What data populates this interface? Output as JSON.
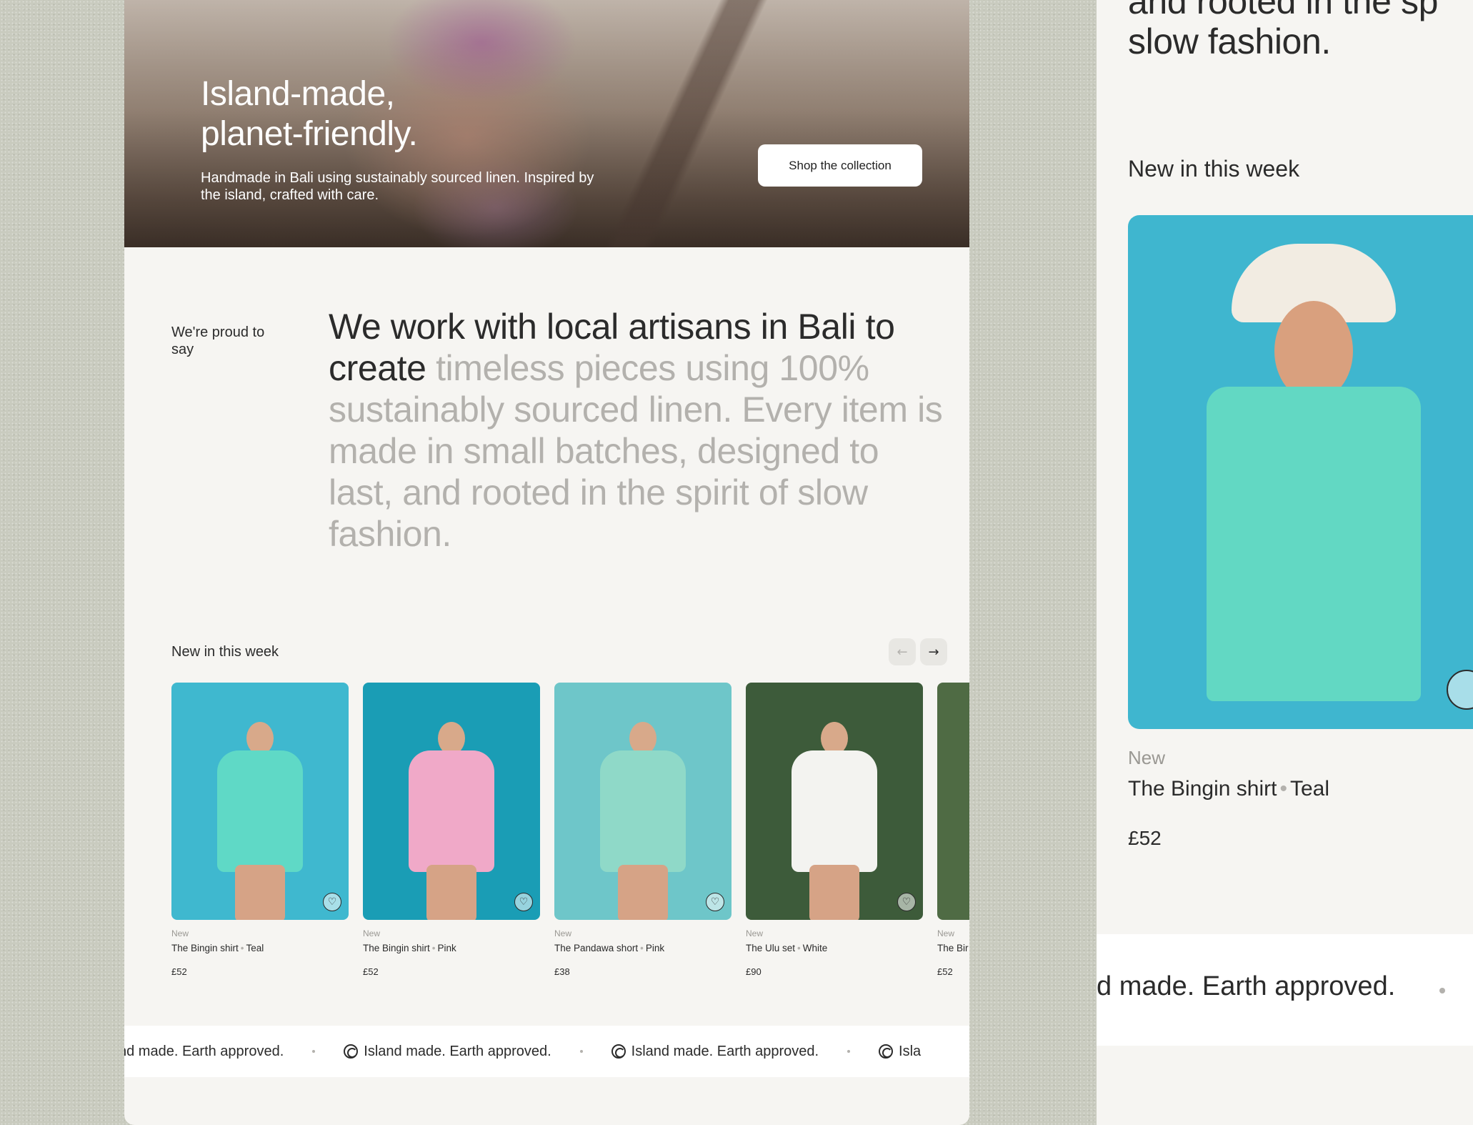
{
  "hero": {
    "title": "Island-made, planet-friendly.",
    "subtitle": "Handmade in Bali using sustainably sourced linen. Inspired by the island, crafted with care.",
    "cta_label": "Shop the collection"
  },
  "about": {
    "eyebrow": "We're proud to say",
    "statement_dark": "We work with local artisans in Bali to create ",
    "statement_light": "timeless pieces using 100% sustainably sourced linen. Every item is made in small batches, designed to last, and rooted in the spirit of slow fashion."
  },
  "new_in": {
    "heading": "New in this week",
    "prev_icon": "arrow-left-icon",
    "next_icon": "arrow-right-icon",
    "products": [
      {
        "tag": "New",
        "name": "The Bingin shirt",
        "color": "Teal",
        "price": "£52",
        "bg": "#3fb8cf",
        "outfit": "#5fd9c6"
      },
      {
        "tag": "New",
        "name": "The Bingin shirt",
        "color": "Pink",
        "price": "£52",
        "bg": "#1a9db5",
        "outfit": "#f0a9c8"
      },
      {
        "tag": "New",
        "name": "The Pandawa short",
        "color": "Pink",
        "price": "£38",
        "bg": "#6ec6c9",
        "outfit": "#8fd9c8"
      },
      {
        "tag": "New",
        "name": "The Ulu set",
        "color": "White",
        "price": "£90",
        "bg": "#3d5b3a",
        "outfit": "#f3f3f0"
      },
      {
        "tag": "New",
        "name": "The Bir",
        "color": "",
        "price": "£52",
        "bg": "#4f6b44",
        "outfit": "#e9e5dc"
      }
    ]
  },
  "marquee": {
    "first_partial": "nd made. Earth approved.",
    "item": "Island made. Earth approved.",
    "last_partial": "Isla",
    "icon": "spiral-icon"
  },
  "zoom": {
    "text_line1": "and rooted in the sp",
    "text_line2": "slow fashion.",
    "heading": "New in this week",
    "tag": "New",
    "name": "The Bingin shirt",
    "color": "Teal",
    "price": "£52",
    "marquee_text": "d made. Earth approved."
  }
}
